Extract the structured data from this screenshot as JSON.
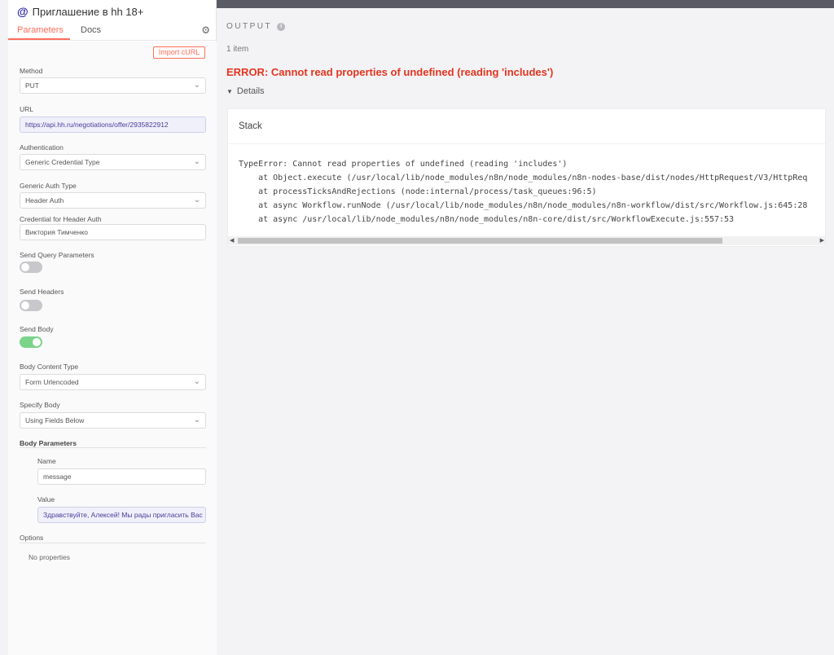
{
  "node": {
    "title": "Приглашение в hh 18+",
    "icon": "at-icon"
  },
  "tabs": [
    {
      "label": "Parameters",
      "active": true
    },
    {
      "label": "Docs",
      "active": false
    }
  ],
  "import_curl": "Import cURL",
  "fields": {
    "method": {
      "label": "Method",
      "value": "PUT"
    },
    "url": {
      "label": "URL",
      "value": "https://api.hh.ru/negotiations/offer/2935822912"
    },
    "authentication": {
      "label": "Authentication",
      "value": "Generic Credential Type"
    },
    "generic_auth_type": {
      "label": "Generic Auth Type",
      "value": "Header Auth"
    },
    "credential": {
      "label": "Credential for Header Auth",
      "value": "Виктория Тимченко"
    },
    "send_query": {
      "label": "Send Query Parameters",
      "on": false
    },
    "send_headers": {
      "label": "Send Headers",
      "on": false
    },
    "send_body": {
      "label": "Send Body",
      "on": true
    },
    "body_content_type": {
      "label": "Body Content Type",
      "value": "Form Urlencoded"
    },
    "specify_body": {
      "label": "Specify Body",
      "value": "Using Fields Below"
    }
  },
  "body_parameters": {
    "title": "Body Parameters",
    "name_label": "Name",
    "name_value": "message",
    "value_label": "Value",
    "value_value": "Здравствуйте, Алексей! Мы рады пригласить Вас"
  },
  "options": {
    "title": "Options",
    "empty": "No properties"
  },
  "output": {
    "heading": "OUTPUT",
    "item_count": "1 item",
    "error": "ERROR: Cannot read properties of undefined (reading 'includes')",
    "details_label": "Details",
    "stack_label": "Stack",
    "stack_lines": [
      "TypeError: Cannot read properties of undefined (reading 'includes')",
      "    at Object.execute (/usr/local/lib/node_modules/n8n/node_modules/n8n-nodes-base/dist/nodes/HttpRequest/V3/HttpReq",
      "    at processTicksAndRejections (node:internal/process/task_queues:96:5)",
      "    at async Workflow.runNode (/usr/local/lib/node_modules/n8n/node_modules/n8n-workflow/dist/src/Workflow.js:645:28",
      "    at async /usr/local/lib/node_modules/n8n/node_modules/n8n-core/dist/src/WorkflowExecute.js:557:53"
    ]
  },
  "colors": {
    "accent": "#ff6d5a",
    "error": "#e3351f",
    "toggle_on": "#7bd48a"
  }
}
